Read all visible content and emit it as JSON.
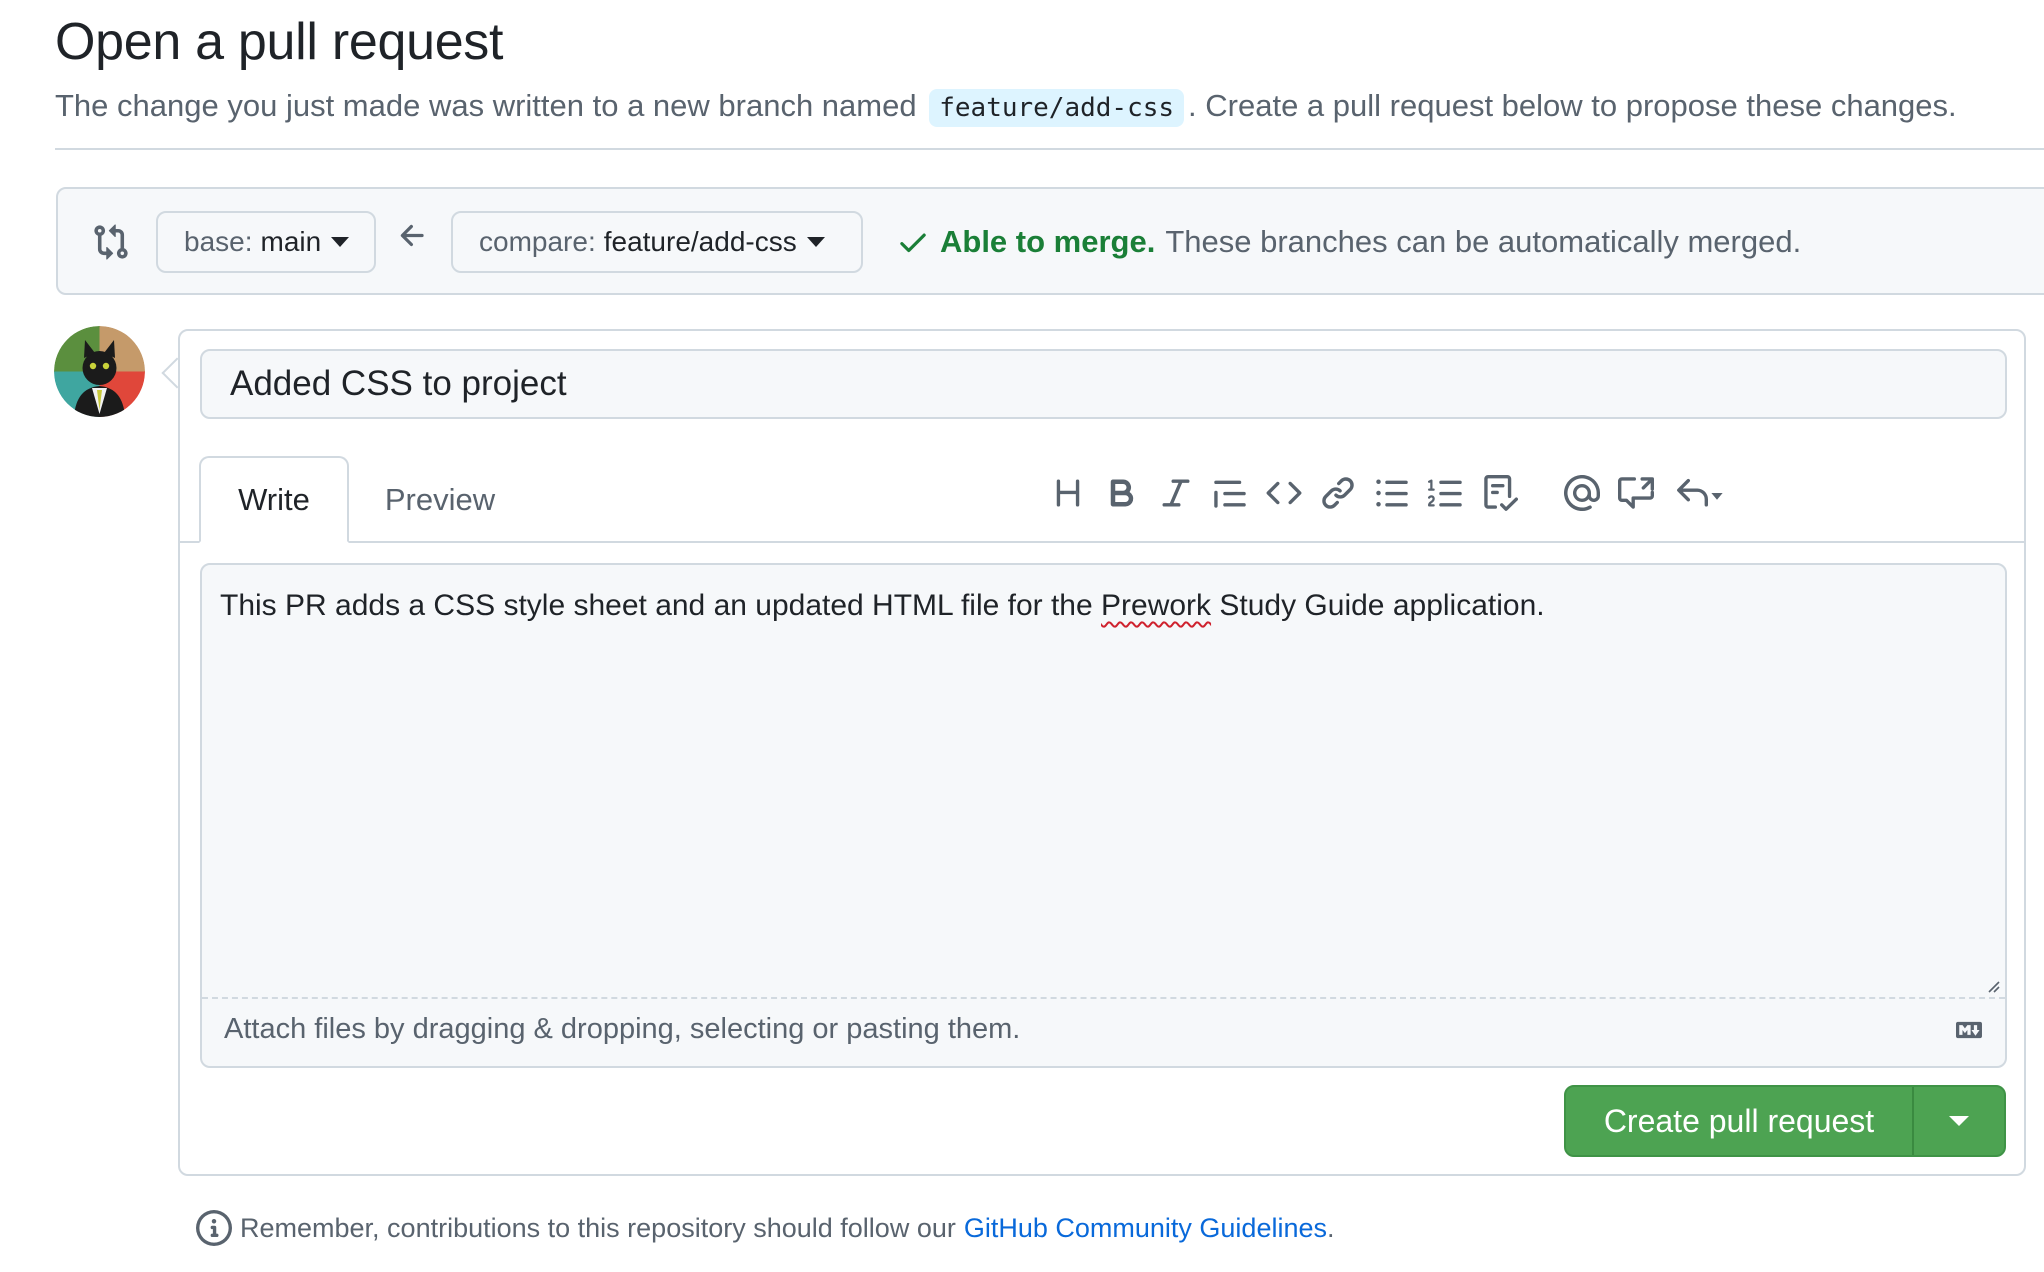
{
  "page": {
    "title": "Open a pull request",
    "subtitle_before": "The change you just made was written to a new branch named",
    "branch_name": "feature/add-css",
    "subtitle_after": ". Create a pull request below to propose these changes."
  },
  "range": {
    "base_prefix": "base:",
    "base_branch": "main",
    "compare_prefix": "compare:",
    "compare_branch": "feature/add-css",
    "merge_ok": "Able to merge.",
    "merge_desc": "These branches can be automatically merged."
  },
  "form": {
    "title_value": "Added CSS to project",
    "tabs": [
      {
        "label": "Write",
        "active": true
      },
      {
        "label": "Preview",
        "active": false
      }
    ],
    "toolbar": [
      "heading-icon",
      "bold-icon",
      "italic-icon",
      "quote-icon",
      "code-icon",
      "link-icon",
      "unordered-list-icon",
      "ordered-list-icon",
      "task-list-icon",
      "mention-icon",
      "reference-icon",
      "saved-replies-icon"
    ],
    "body_before": "This PR adds a CSS style sheet and an updated HTML file for the ",
    "body_misspelled": "Prework",
    "body_after": " Study Guide application.",
    "attach_hint": "Attach files by dragging & dropping, selecting or pasting them.",
    "submit_label": "Create pull request"
  },
  "footer": {
    "note": "Remember, contributions to this repository should follow our",
    "link": "GitHub Community Guidelines",
    "period": "."
  },
  "colors": {
    "success": "#1a7f37",
    "button_green": "#4da352",
    "link_blue": "#0969da",
    "branch_badge_bg": "#ddf4ff"
  }
}
